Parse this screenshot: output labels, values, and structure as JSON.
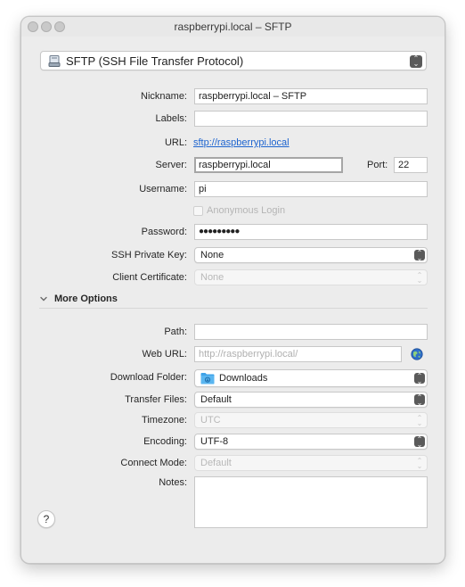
{
  "window": {
    "title": "raspberrypi.local – SFTP"
  },
  "protocol": {
    "selected": "SFTP (SSH File Transfer Protocol)"
  },
  "form": {
    "nickname_label": "Nickname:",
    "nickname_value": "raspberrypi.local – SFTP",
    "labels_label": "Labels:",
    "labels_value": "",
    "url_label": "URL:",
    "url_value": "sftp://raspberrypi.local",
    "server_label": "Server:",
    "server_value": "raspberrypi.local",
    "port_label": "Port:",
    "port_value": "22",
    "username_label": "Username:",
    "username_value": "pi",
    "anonymous_label": "Anonymous Login",
    "password_label": "Password:",
    "password_value": "●●●●●●●●●",
    "ssh_key_label": "SSH Private Key:",
    "ssh_key_value": "None",
    "client_cert_label": "Client Certificate:",
    "client_cert_value": "None"
  },
  "more_options": {
    "header": "More Options",
    "path_label": "Path:",
    "path_value": "",
    "web_url_label": "Web URL:",
    "web_url_placeholder": "http://raspberrypi.local/",
    "download_folder_label": "Download Folder:",
    "download_folder_value": "Downloads",
    "transfer_files_label": "Transfer Files:",
    "transfer_files_value": "Default",
    "timezone_label": "Timezone:",
    "timezone_value": "UTC",
    "encoding_label": "Encoding:",
    "encoding_value": "UTF-8",
    "connect_mode_label": "Connect Mode:",
    "connect_mode_value": "Default",
    "notes_label": "Notes:",
    "notes_value": ""
  },
  "help": {
    "label": "?"
  },
  "icons": {
    "protocol": "drive-icon",
    "web_url": "globe-icon",
    "download_folder": "folder-icon",
    "more_options": "chevron-down-icon"
  },
  "colors": {
    "link": "#1d64cf",
    "folder": "#3fa3e8",
    "accent": "#5a5a5a"
  }
}
